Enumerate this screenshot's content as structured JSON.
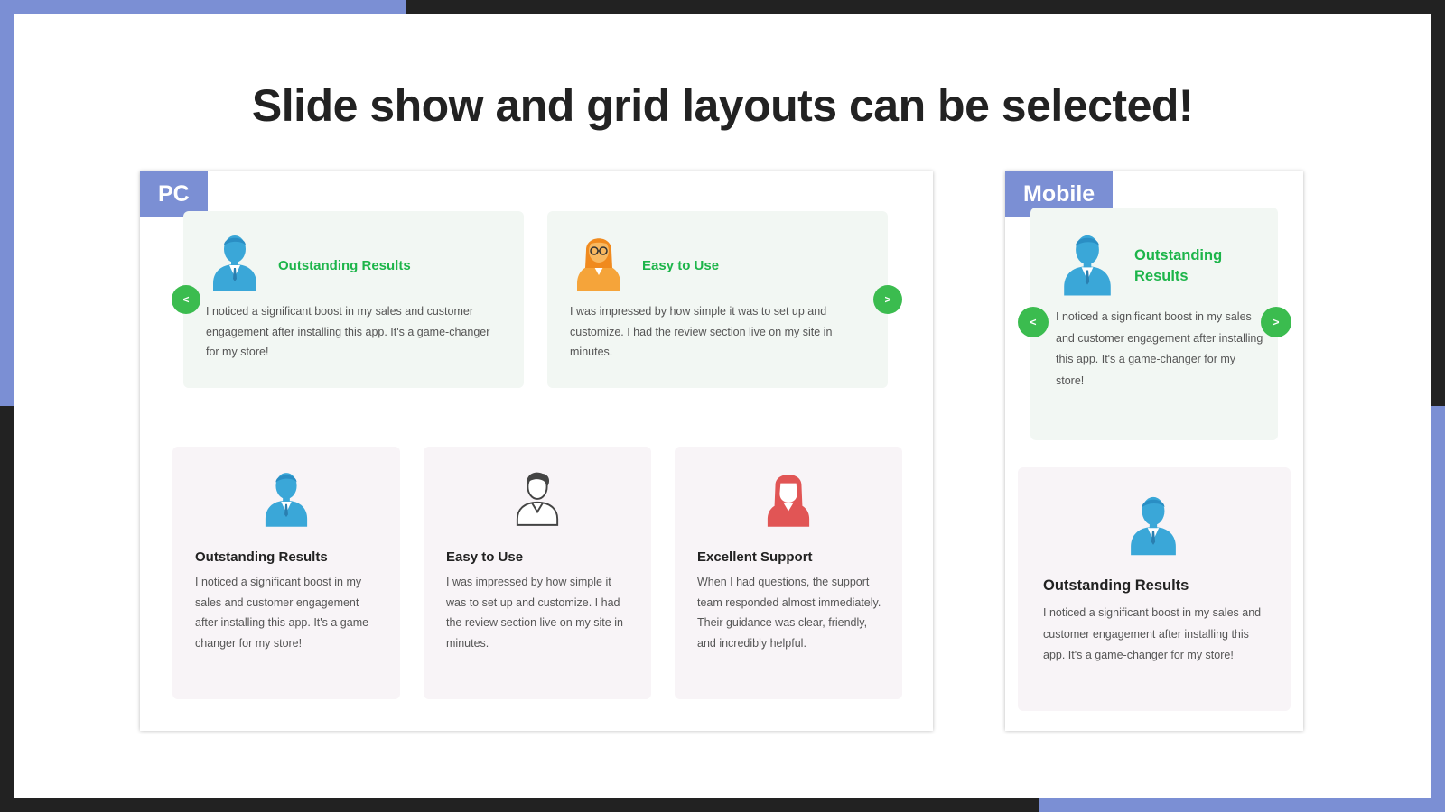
{
  "headline": "Slide show and grid layouts can be selected!",
  "colors": {
    "accent": "#7b8fd4",
    "green_title": "#1db54a",
    "arrow_bg": "#3bbc4f",
    "slide_bg": "#f2f7f3",
    "card_bg": "#f8f4f7",
    "blue_person": "#3aa7d8",
    "orange_person": "#f5a43a",
    "gray_person": "#555555",
    "red_person": "#e15555"
  },
  "pc": {
    "tag": "PC",
    "prev_arrow": "<",
    "next_arrow": ">",
    "slides": [
      {
        "icon": "blue-man-icon",
        "title": "Outstanding Results",
        "text": "I noticed a significant boost in my sales and customer engagement after installing this app. It's a game-changer for my store!"
      },
      {
        "icon": "orange-woman-glasses-icon",
        "title": "Easy to Use",
        "text": "I was impressed by how simple it was to set up and customize. I had the review section live on my site in minutes."
      }
    ],
    "cards": [
      {
        "icon": "blue-man-icon",
        "title": "Outstanding Results",
        "text": "I noticed a significant boost in my sales and customer engagement after installing this app. It's a game-changer for my store!"
      },
      {
        "icon": "gray-man-outline-icon",
        "title": "Easy to Use",
        "text": "I was impressed by how simple it was to set up and customize. I had the review section live on my site in minutes."
      },
      {
        "icon": "red-woman-icon",
        "title": "Excellent Support",
        "text": "When I had questions, the support team responded almost immediately. Their guidance was clear, friendly, and incredibly helpful."
      }
    ]
  },
  "mobile": {
    "tag": "Mobile",
    "prev_arrow": "<",
    "next_arrow": ">",
    "slide": {
      "icon": "blue-man-icon",
      "title": "Outstanding Results",
      "text": "I noticed a significant boost in my sales and customer engagement after installing this app. It's a game-changer for my store!"
    },
    "card": {
      "icon": "blue-man-icon",
      "title": "Outstanding Results",
      "text": "I noticed a significant boost in my sales and customer engagement after installing this app. It's a game-changer for my store!"
    }
  }
}
